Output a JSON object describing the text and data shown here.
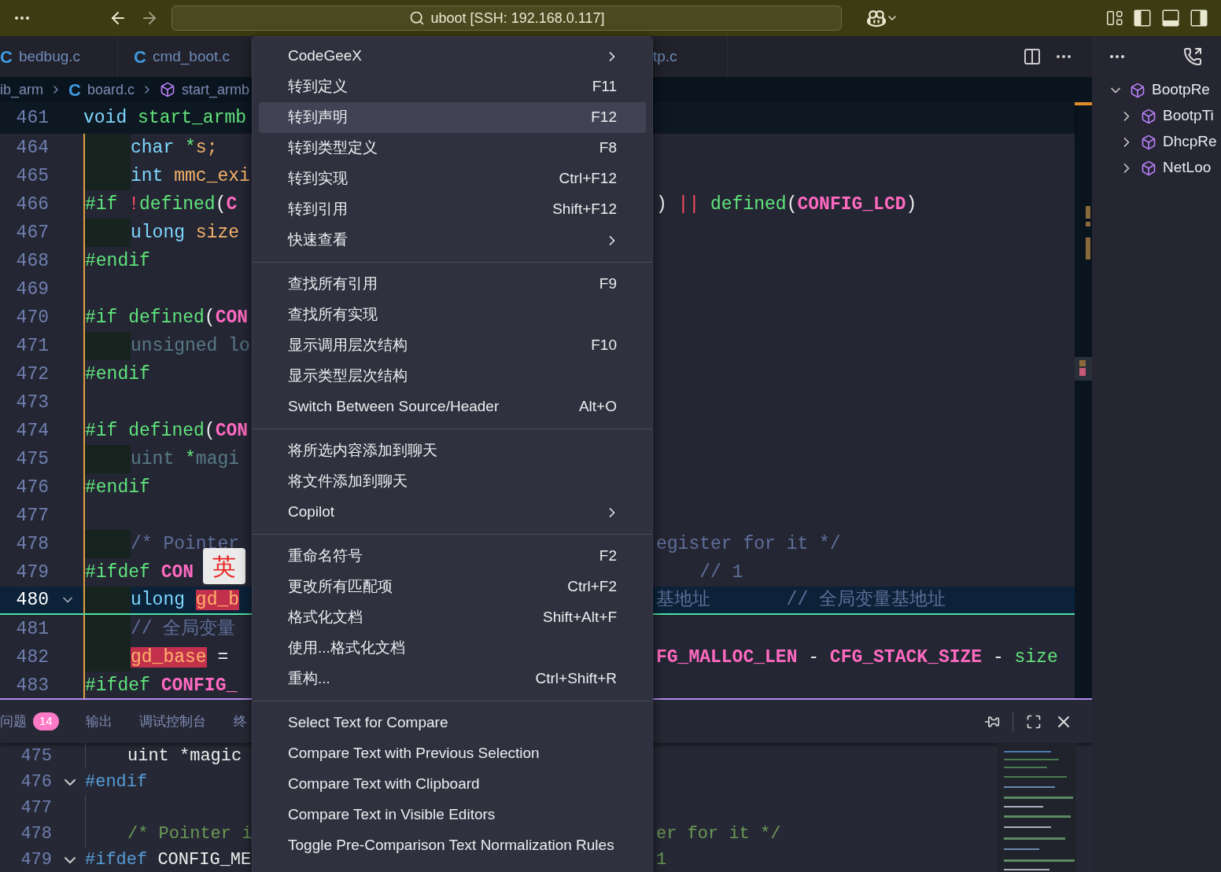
{
  "title_bar": {
    "search": "uboot [SSH: 192.168.0.117]"
  },
  "tabs": [
    {
      "icon": "C",
      "label": "bedbug.c"
    },
    {
      "icon": "C",
      "label": "cmd_boot.c"
    },
    {
      "label": "tp.c"
    }
  ],
  "breadcrumb": {
    "folder": "ib_arm",
    "file_icon": "C",
    "file": "board.c",
    "symbol": "start_armb"
  },
  "sticky_line": {
    "number": "461",
    "left": [
      {
        "text": "void",
        "kind": "kw"
      },
      {
        "text": " start_armb",
        "kind": "fn"
      }
    ]
  },
  "code_lines": [
    {
      "number": "464",
      "indent": true,
      "current": false,
      "left": [
        {
          "text": "char",
          "kind": "kw"
        },
        {
          "text": " *",
          "kind": "fn"
        },
        {
          "text": "s;",
          "kind": "var"
        }
      ]
    },
    {
      "number": "465",
      "indent": true,
      "current": false,
      "left": [
        {
          "text": "int",
          "kind": "kw"
        },
        {
          "text": " mmc_exi",
          "kind": "var"
        }
      ]
    },
    {
      "number": "466",
      "indent": false,
      "current": false,
      "left": [
        {
          "text": "#if ",
          "kind": "pre"
        },
        {
          "text": "!",
          "kind": "op"
        },
        {
          "text": "defined",
          "kind": "pre"
        },
        {
          "text": "(",
          "kind": "plain"
        },
        {
          "text": "C",
          "kind": "macro"
        }
      ],
      "right": [
        {
          "text": ")",
          "kind": "plain"
        },
        {
          "text": " || ",
          "kind": "op"
        },
        {
          "text": "defined",
          "kind": "pre"
        },
        {
          "text": "(",
          "kind": "plain"
        },
        {
          "text": "CONFIG_LCD",
          "kind": "macro"
        },
        {
          "text": ")",
          "kind": "plain"
        }
      ]
    },
    {
      "number": "467",
      "indent": true,
      "current": false,
      "left": [
        {
          "text": "ulong",
          "kind": "kw"
        },
        {
          "text": " size",
          "kind": "var"
        }
      ]
    },
    {
      "number": "468",
      "indent": false,
      "current": false,
      "left": [
        {
          "text": "#endif",
          "kind": "pre"
        }
      ]
    },
    {
      "number": "469",
      "indent": false,
      "current": false
    },
    {
      "number": "470",
      "indent": false,
      "current": false,
      "left": [
        {
          "text": "#if defined",
          "kind": "pre"
        },
        {
          "text": "(",
          "kind": "plain"
        },
        {
          "text": "CON",
          "kind": "macro"
        }
      ]
    },
    {
      "number": "471",
      "indent": true,
      "current": false,
      "left": [
        {
          "text": "unsigned lo",
          "kind": "inactive"
        }
      ]
    },
    {
      "number": "472",
      "indent": false,
      "current": false,
      "left": [
        {
          "text": "#endif",
          "kind": "pre"
        }
      ]
    },
    {
      "number": "473",
      "indent": false,
      "current": false
    },
    {
      "number": "474",
      "indent": false,
      "current": false,
      "left": [
        {
          "text": "#if defined",
          "kind": "pre"
        },
        {
          "text": "(",
          "kind": "plain"
        },
        {
          "text": "CON",
          "kind": "macro"
        }
      ]
    },
    {
      "number": "475",
      "indent": true,
      "current": false,
      "left": [
        {
          "text": "uint ",
          "kind": "inactive"
        },
        {
          "text": "*",
          "kind": "fn"
        },
        {
          "text": "magi",
          "kind": "inactive"
        }
      ]
    },
    {
      "number": "476",
      "indent": false,
      "current": false,
      "left": [
        {
          "text": "#endif",
          "kind": "pre"
        }
      ]
    },
    {
      "number": "477",
      "indent": false,
      "current": false
    },
    {
      "number": "478",
      "indent": true,
      "current": false,
      "left": [
        {
          "text": "/* Pointer",
          "kind": "comment"
        }
      ],
      "right": [
        {
          "text": "egister for it */",
          "kind": "comment"
        }
      ]
    },
    {
      "number": "479",
      "indent": false,
      "current": false,
      "left": [
        {
          "text": "#ifdef ",
          "kind": "pre"
        },
        {
          "text": "CON",
          "kind": "macro"
        }
      ],
      "right": [
        {
          "text": "    // 1",
          "kind": "comment"
        }
      ]
    },
    {
      "number": "480",
      "indent": true,
      "current": true,
      "left": [
        {
          "text": "ulong ",
          "kind": "kw"
        },
        {
          "text": "gd_b",
          "kind": "hl"
        }
      ],
      "right": [
        {
          "text": "基地址       // 全局变量基地址",
          "kind": "comment"
        }
      ]
    },
    {
      "number": "481",
      "indent": true,
      "current": false,
      "left": [
        {
          "text": "// 全局变量",
          "kind": "comment"
        }
      ]
    },
    {
      "number": "482",
      "indent": true,
      "current": false,
      "left": [
        {
          "text": "gd_base",
          "kind": "hl"
        },
        {
          "text": " =",
          "kind": "plain"
        }
      ],
      "right": [
        {
          "text": "FG_MALLOC_LEN",
          "kind": "macro"
        },
        {
          "text": " - ",
          "kind": "plain"
        },
        {
          "text": "CFG_STACK_SIZE",
          "kind": "macro"
        },
        {
          "text": " - ",
          "kind": "plain"
        },
        {
          "text": "size",
          "kind": "fn"
        }
      ]
    },
    {
      "number": "483",
      "indent": false,
      "current": false,
      "left": [
        {
          "text": "#ifdef ",
          "kind": "pre"
        },
        {
          "text": "CONFIG_",
          "kind": "macro"
        }
      ]
    }
  ],
  "ime_indicator": "英",
  "context_menu": {
    "groups": [
      [
        {
          "label": "CodeGeeX",
          "submenu": true,
          "selected": false
        },
        {
          "label": "转到定义",
          "shortcut": "F11",
          "submenu": false,
          "selected": false
        },
        {
          "label": "转到声明",
          "shortcut": "F12",
          "submenu": false,
          "selected": true
        },
        {
          "label": "转到类型定义",
          "shortcut": "F8",
          "submenu": false,
          "selected": false
        },
        {
          "label": "转到实现",
          "shortcut": "Ctrl+F12",
          "submenu": false,
          "selected": false
        },
        {
          "label": "转到引用",
          "shortcut": "Shift+F12",
          "submenu": false,
          "selected": false
        },
        {
          "label": "快速查看",
          "submenu": true,
          "selected": false
        }
      ],
      [
        {
          "label": "查找所有引用",
          "shortcut": "F9",
          "submenu": false,
          "selected": false
        },
        {
          "label": "查找所有实现",
          "submenu": false,
          "selected": false
        },
        {
          "label": "显示调用层次结构",
          "shortcut": "F10",
          "submenu": false,
          "selected": false
        },
        {
          "label": "显示类型层次结构",
          "submenu": false,
          "selected": false
        },
        {
          "label": "Switch Between Source/Header",
          "shortcut": "Alt+O",
          "submenu": false,
          "selected": false
        }
      ],
      [
        {
          "label": "将所选内容添加到聊天",
          "submenu": false,
          "selected": false
        },
        {
          "label": "将文件添加到聊天",
          "submenu": false,
          "selected": false
        },
        {
          "label": "Copilot",
          "submenu": true,
          "selected": false
        }
      ],
      [
        {
          "label": "重命名符号",
          "shortcut": "F2",
          "submenu": false,
          "selected": false
        },
        {
          "label": "更改所有匹配项",
          "shortcut": "Ctrl+F2",
          "submenu": false,
          "selected": false
        },
        {
          "label": "格式化文档",
          "shortcut": "Shift+Alt+F",
          "submenu": false,
          "selected": false
        },
        {
          "label": "使用...格式化文档",
          "submenu": false,
          "selected": false
        },
        {
          "label": "重构...",
          "shortcut": "Ctrl+Shift+R",
          "submenu": false,
          "selected": false
        }
      ],
      [
        {
          "label": "Select Text for Compare",
          "submenu": false,
          "selected": false
        },
        {
          "label": "Compare Text with Previous Selection",
          "submenu": false,
          "selected": false
        },
        {
          "label": "Compare Text with Clipboard",
          "submenu": false,
          "selected": false
        },
        {
          "label": "Compare Text in Visible Editors",
          "submenu": false,
          "selected": false
        },
        {
          "label": "Toggle Pre-Comparison Text Normalization Rules",
          "submenu": false,
          "selected": false
        }
      ]
    ]
  },
  "panel": {
    "tabs": [
      {
        "label": "问题",
        "badge": "14"
      },
      {
        "label": "输出"
      },
      {
        "label": "调试控制台"
      },
      {
        "label": "终"
      }
    ],
    "lines": [
      {
        "number": "475",
        "indent": true,
        "left": [
          {
            "text": "uint *magic",
            "kind": "plain"
          }
        ]
      },
      {
        "number": "476",
        "fold": true,
        "left": [
          {
            "text": "#endif",
            "kind": "pre2"
          }
        ]
      },
      {
        "number": "477",
        "indent": true
      },
      {
        "number": "478",
        "indent": true,
        "left": [
          {
            "text": "/* Pointer i",
            "kind": "comment2"
          }
        ],
        "right": [
          {
            "text": "er for it */",
            "kind": "comment2"
          }
        ]
      },
      {
        "number": "479",
        "fold": true,
        "left": [
          {
            "text": "#ifdef",
            "kind": "pre2"
          },
          {
            "text": " CONFIG_ME",
            "kind": "plain"
          }
        ],
        "right": [
          {
            "text": "1",
            "kind": "comment2"
          }
        ]
      }
    ]
  },
  "outline": [
    {
      "label": "BootpRe",
      "expanded": true,
      "children": [
        {
          "label": "BootpTi",
          "expanded": false
        },
        {
          "label": "DhcpRe",
          "expanded": false
        },
        {
          "label": "NetLoo",
          "expanded": false
        }
      ]
    }
  ]
}
